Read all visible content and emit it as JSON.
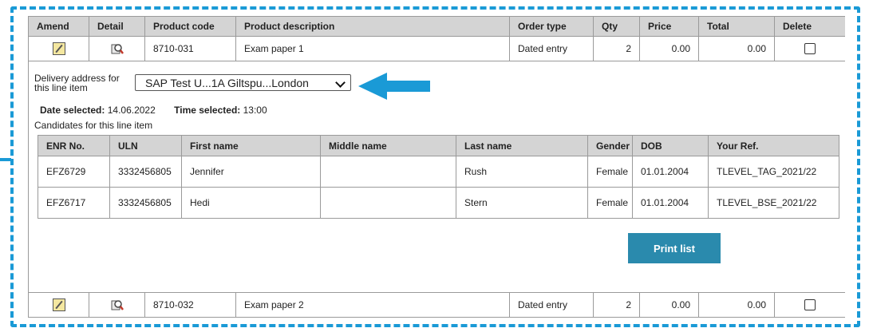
{
  "columns": {
    "amend": "Amend",
    "detail": "Detail",
    "product_code": "Product code",
    "product_description": "Product description",
    "order_type": "Order type",
    "qty": "Qty",
    "price": "Price",
    "total": "Total",
    "delete": "Delete"
  },
  "rows": [
    {
      "product_code": "8710-031",
      "description": "Exam paper 1",
      "order_type": "Dated entry",
      "qty": "2",
      "price": "0.00",
      "total": "0.00"
    },
    {
      "product_code": "8710-032",
      "description": "Exam paper 2",
      "order_type": "Dated entry",
      "qty": "2",
      "price": "0.00",
      "total": "0.00"
    }
  ],
  "detail": {
    "address_label": "Delivery address for this line item",
    "address_value": "SAP Test U...1A Giltspu...London",
    "date_label": "Date selected:",
    "date_value": "14.06.2022",
    "time_label": "Time selected:",
    "time_value": "13:00",
    "candidates_label": "Candidates for this line item",
    "print_button": "Print list"
  },
  "candidate_columns": {
    "enr": "ENR No.",
    "uln": "ULN",
    "first_name": "First name",
    "middle_name": "Middle name",
    "last_name": "Last name",
    "gender": "Gender",
    "dob": "DOB",
    "your_ref": "Your Ref."
  },
  "candidates": [
    {
      "enr": "EFZ6729",
      "uln": "3332456805",
      "first_name": "Jennifer",
      "middle_name": "",
      "last_name": "Rush",
      "gender": "Female",
      "dob": "01.01.2004",
      "your_ref": "TLEVEL_TAG_2021/22"
    },
    {
      "enr": "EFZ6717",
      "uln": "3332456805",
      "first_name": "Hedi",
      "middle_name": "",
      "last_name": "Stern",
      "gender": "Female",
      "dob": "01.01.2004",
      "your_ref": "TLEVEL_BSE_2021/22"
    }
  ],
  "icons": {
    "amend": "pencil-icon",
    "detail": "magnifier-icon"
  },
  "colors": {
    "highlight": "#1a9ad6",
    "button": "#2a8aad",
    "header_bg": "#d4d4d4"
  }
}
